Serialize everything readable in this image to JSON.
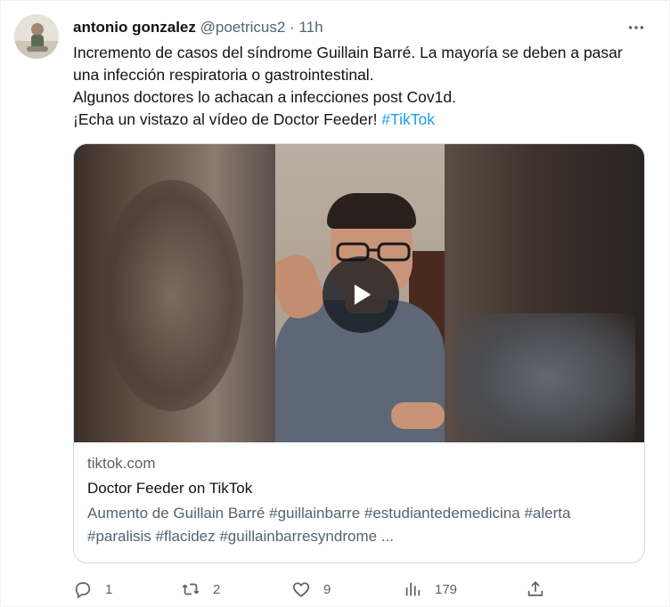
{
  "author": {
    "name": "antonio gonzalez",
    "handle": "@poetricus2",
    "separator": "·",
    "time": "11h"
  },
  "tweet": {
    "line1": "Incremento de casos del síndrome Guillain Barré. La mayoría se deben a pasar una infección respiratoria o gastrointestinal.",
    "line2": "Algunos doctores lo achacan a infecciones post Cov1d.",
    "line3": "¡Echa un vistazo al vídeo de Doctor Feeder! ",
    "hashtag": "#TikTok"
  },
  "card": {
    "domain": "tiktok.com",
    "title": "Doctor Feeder on TikTok",
    "description": "Aumento de Guillain Barré #guillainbarre #estudiantedemedicina #alerta #paralisis #flacidez #guillainbarresyndrome ..."
  },
  "actions": {
    "replies": "1",
    "retweets": "2",
    "likes": "9",
    "views": "179"
  },
  "icons": {
    "more": "more-horizontal-icon",
    "play": "play-icon",
    "reply": "reply-icon",
    "retweet": "retweet-icon",
    "like": "heart-icon",
    "views": "views-icon",
    "share": "share-icon"
  },
  "colors": {
    "link": "#1d9bf0",
    "secondary_text": "#536471",
    "border": "#cfd9de"
  }
}
